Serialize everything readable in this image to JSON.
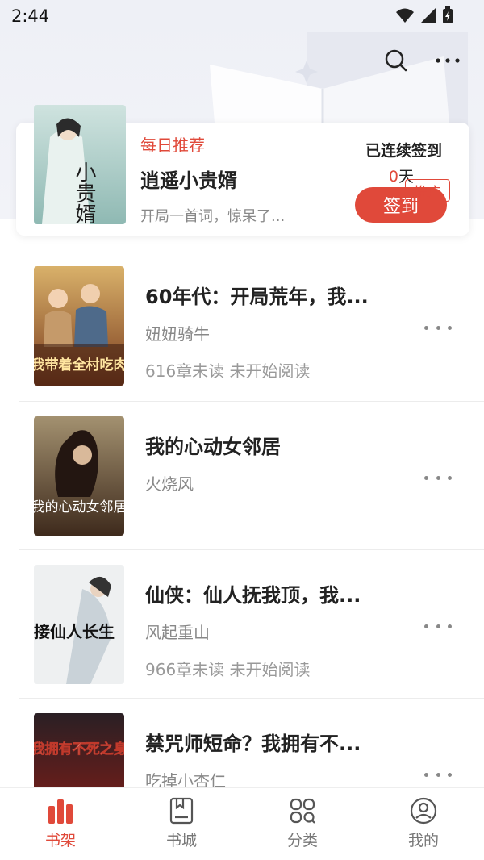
{
  "status_bar": {
    "time": "2:44"
  },
  "daily": {
    "tag": "每日推荐",
    "title": "逍遥小贵婿",
    "desc": "开局一首词，惊呆了...",
    "cover_text": "小贵婿",
    "streak_label": "已连续签到",
    "streak_days": "0",
    "streak_unit": "天",
    "signin_label": "签到"
  },
  "books": [
    {
      "title": "60年代：开局荒年，我...",
      "author": "妞妞骑牛",
      "progress": "616章未读 未开始阅读",
      "cover_text": "我带着全村吃肉",
      "ad": ""
    },
    {
      "title": "我的心动女邻居",
      "author": "火烧风",
      "progress": "",
      "cover_text": "我的心动女邻居",
      "ad": "推广"
    },
    {
      "title": "仙侠：仙人抚我顶，我...",
      "author": "风起重山",
      "progress": "966章未读 未开始阅读",
      "cover_text": "我接仙人长生",
      "ad": ""
    },
    {
      "title": "禁咒师短命？我拥有不...",
      "author": "吃掉小杏仁",
      "progress": "",
      "cover_text": "我拥有不死之身",
      "ad": ""
    }
  ],
  "nav": [
    {
      "label": "书架",
      "active": true
    },
    {
      "label": "书城",
      "active": false
    },
    {
      "label": "分类",
      "active": false
    },
    {
      "label": "我的",
      "active": false
    }
  ],
  "colors": {
    "accent": "#e0493a",
    "muted": "#888888"
  }
}
